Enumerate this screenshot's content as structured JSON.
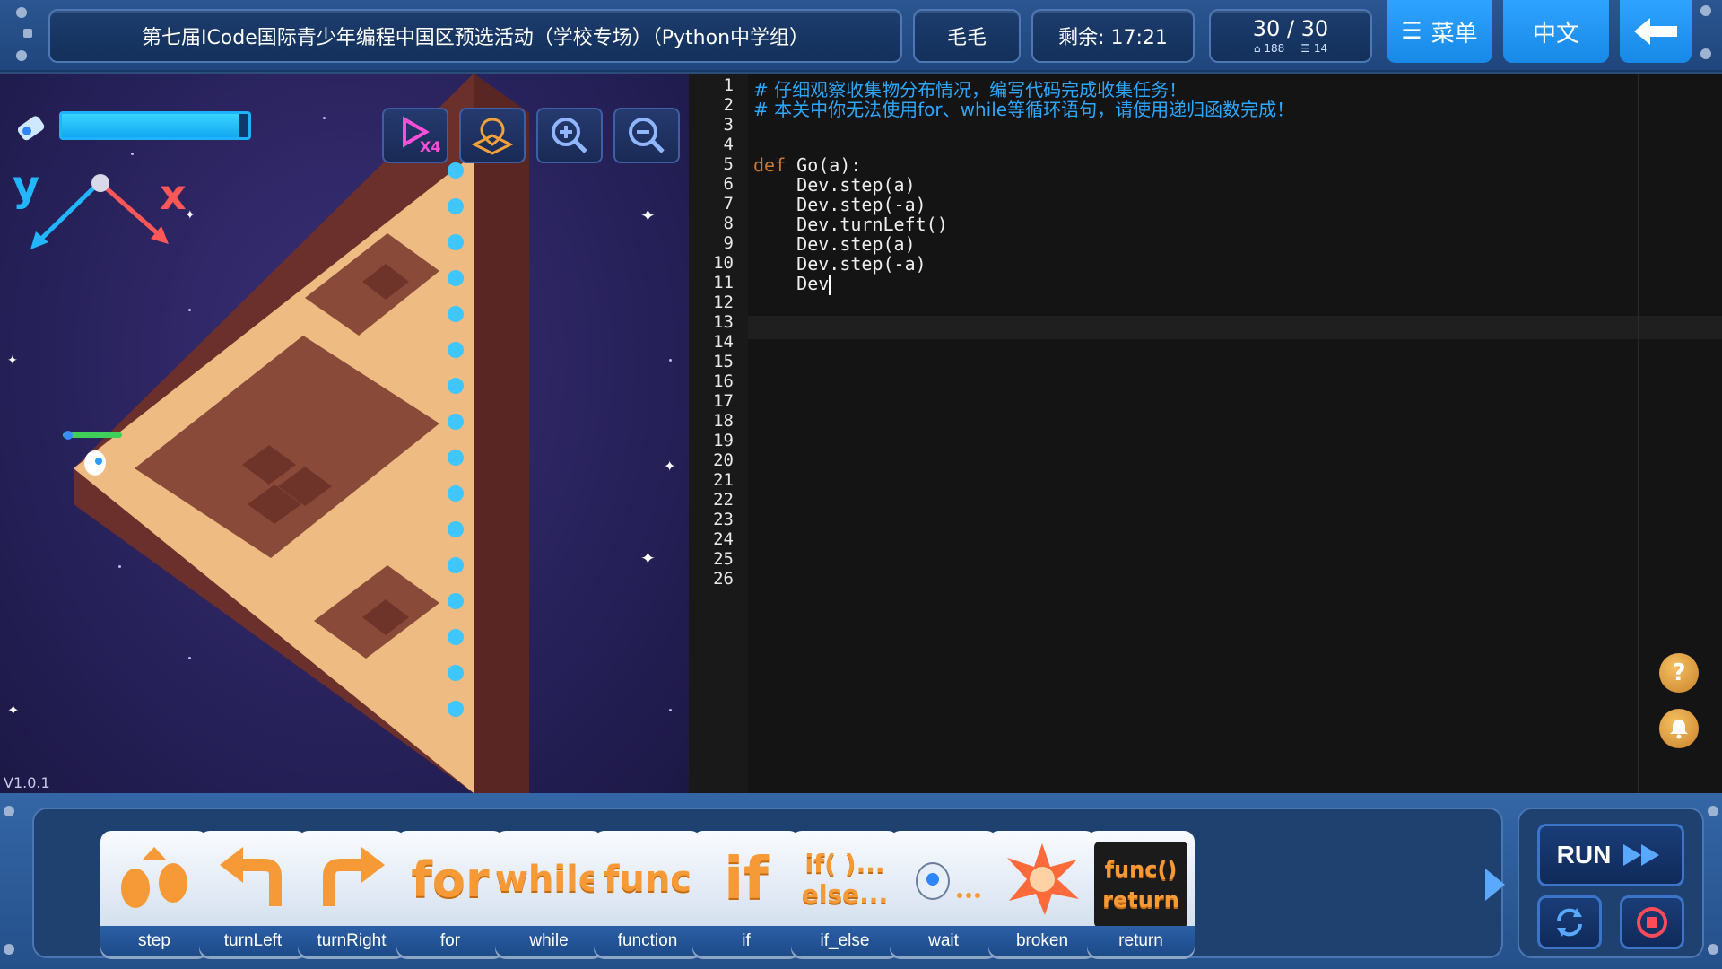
{
  "header": {
    "title": "第七届ICode国际青少年编程中国区预选活动（学校专场）（Python中学组）",
    "user": "毛毛",
    "timer": "剩余: 17:21",
    "progress": "30 / 30",
    "stat_a": "188",
    "stat_b": "14",
    "menu_label": "菜单",
    "lang_label": "中文"
  },
  "game": {
    "axis_y": "y",
    "axis_x": "x",
    "version": "V1.0.1",
    "energy_percent": 95,
    "speed_label": "X4"
  },
  "editor": {
    "line_numbers": [
      "1",
      "2",
      "3",
      "4",
      "5",
      "6",
      "7",
      "8",
      "9",
      "10",
      "11",
      "12",
      "13",
      "14",
      "15",
      "16",
      "17",
      "18",
      "19",
      "20",
      "21",
      "22",
      "23",
      "24",
      "25",
      "26"
    ],
    "lines": [
      {
        "comment": "# 仔细观察收集物分布情况，编写代码完成收集任务！"
      },
      {
        "comment": "# 本关中你无法使用for、while等循环语句，请使用递归函数完成！"
      },
      {
        "text": ""
      },
      {
        "text": ""
      },
      {
        "kw": "def",
        "text": " Go(a):"
      },
      {
        "text": "    Dev.step(a)"
      },
      {
        "text": "    Dev.step(-a)"
      },
      {
        "text": "    Dev.turnLeft()"
      },
      {
        "text": "    Dev.step(a)"
      },
      {
        "text": "    Dev.step(-a)"
      },
      {
        "text": "    Dev"
      }
    ]
  },
  "blocks": [
    {
      "label": "step",
      "art": "step"
    },
    {
      "label": "turnLeft",
      "art": "turnLeft"
    },
    {
      "label": "turnRight",
      "art": "turnRight"
    },
    {
      "label": "for",
      "art": "for"
    },
    {
      "label": "while",
      "art": "while"
    },
    {
      "label": "function",
      "art": "func"
    },
    {
      "label": "if",
      "art": "if"
    },
    {
      "label": "if_else",
      "art": "if( )...\nelse..."
    },
    {
      "label": "wait",
      "art": "wait"
    },
    {
      "label": "broken",
      "art": "broken"
    },
    {
      "label": "return",
      "art": "func()\nreturn"
    }
  ],
  "run": {
    "label": "RUN"
  },
  "colors": {
    "accent": "#1789e6",
    "comment": "#2ea8ff",
    "keyword": "#cc7832",
    "block_text": "#f59a36"
  }
}
